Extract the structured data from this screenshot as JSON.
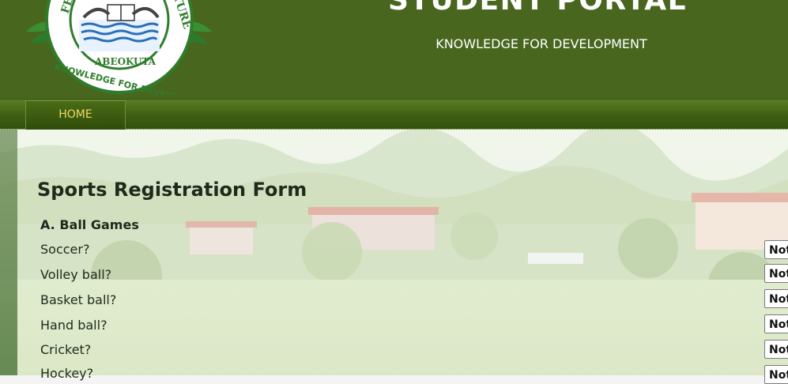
{
  "header": {
    "title": "STUDENT PORTAL",
    "tagline": "KNOWLEDGE FOR DEVELOPMENT",
    "logo": {
      "text_left": "FEDERA",
      "text_right": "ULTURE",
      "text_mid": "ABEOKUTA",
      "text_bottom": "KNOWLEDGE FOR DEVELOPMENT"
    }
  },
  "nav": {
    "items": [
      {
        "label": "HOME"
      }
    ]
  },
  "form": {
    "title": "Sports Registration Form",
    "section_a": "A.  Ball Games",
    "rows": [
      {
        "label": "Soccer?",
        "selected": "Not"
      },
      {
        "label": "Volley ball?",
        "selected": "Not"
      },
      {
        "label": "Basket ball?",
        "selected": "Not"
      },
      {
        "label": "Hand ball?",
        "selected": "Not"
      },
      {
        "label": "Cricket?",
        "selected": "Not"
      },
      {
        "label": "Hockey?",
        "selected": "Not"
      }
    ]
  }
}
